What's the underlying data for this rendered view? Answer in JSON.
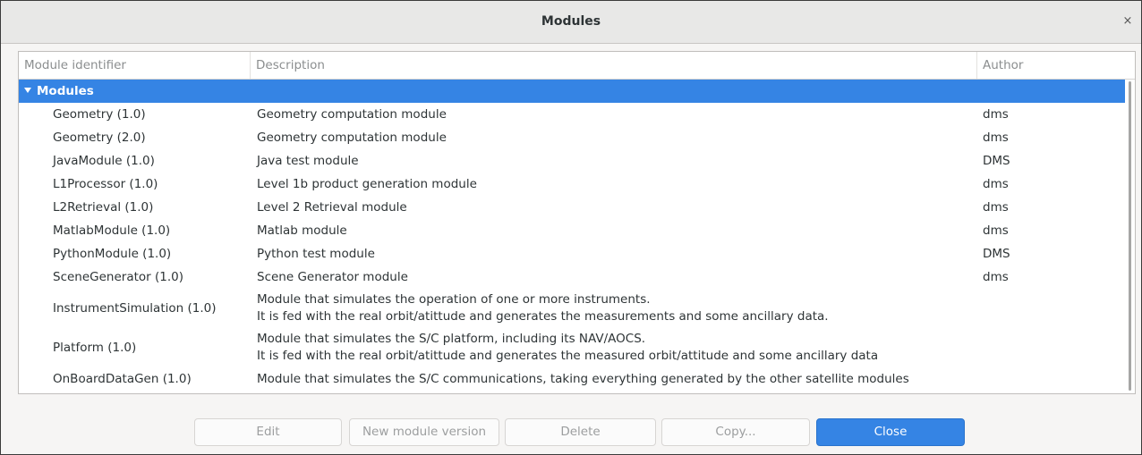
{
  "window": {
    "title": "Modules",
    "close_glyph": "×"
  },
  "columns": [
    "Module identifier",
    "Description",
    "Author"
  ],
  "group": {
    "label": "Modules",
    "expanded": true
  },
  "rows": [
    {
      "module": "Geometry (1.0)",
      "description": [
        "Geometry computation module"
      ],
      "author": "dms"
    },
    {
      "module": "Geometry (2.0)",
      "description": [
        "Geometry computation module"
      ],
      "author": "dms"
    },
    {
      "module": "JavaModule (1.0)",
      "description": [
        "Java test module"
      ],
      "author": "DMS"
    },
    {
      "module": "L1Processor (1.0)",
      "description": [
        "Level 1b product generation module"
      ],
      "author": "dms"
    },
    {
      "module": "L2Retrieval (1.0)",
      "description": [
        "Level 2 Retrieval module"
      ],
      "author": "dms"
    },
    {
      "module": "MatlabModule (1.0)",
      "description": [
        "Matlab module"
      ],
      "author": "dms"
    },
    {
      "module": "PythonModule (1.0)",
      "description": [
        "Python test module"
      ],
      "author": "DMS"
    },
    {
      "module": "SceneGenerator (1.0)",
      "description": [
        "Scene Generator module"
      ],
      "author": "dms"
    },
    {
      "module": "InstrumentSimulation (1.0)",
      "description": [
        "Module that simulates the operation of one or more instruments.",
        "It is fed with the real orbit/atittude and generates the measurements and some ancillary data."
      ],
      "author": ""
    },
    {
      "module": "Platform (1.0)",
      "description": [
        "Module that simulates the S/C platform, including its NAV/AOCS.",
        "It is fed with the real orbit/atittude and generates the measured orbit/attitude and some ancillary data"
      ],
      "author": ""
    },
    {
      "module": "OnBoardDataGen (1.0)",
      "description": [
        "Module that simulates the S/C communications, taking everything generated by the other satellite modules"
      ],
      "author": ""
    }
  ],
  "buttons": {
    "edit": "Edit",
    "new_version": "New module version",
    "delete": "Delete",
    "copy": "Copy...",
    "close": "Close"
  },
  "colors": {
    "accent": "#3584e4",
    "window_bg": "#f6f5f4",
    "titlebar_bg": "#e8e8e7"
  },
  "icons": {
    "group_toggle": "chevron-down-icon",
    "window_close": "close-icon"
  }
}
